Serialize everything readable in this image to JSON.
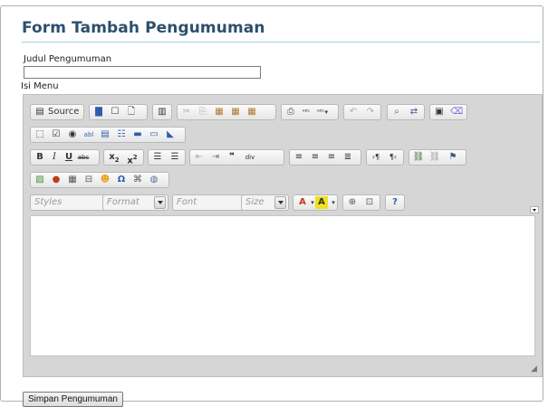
{
  "form": {
    "title": "Form Tambah Pengumuman",
    "judul_label": "Judul Pengumuman",
    "judul_value": "",
    "isi_label": "Isi Menu",
    "submit_label": "Simpan Pengumuman"
  },
  "editor": {
    "source_label": "Source",
    "combos": {
      "styles": "Styles",
      "format": "Format",
      "font": "Font",
      "size": "Size"
    },
    "content": ""
  }
}
